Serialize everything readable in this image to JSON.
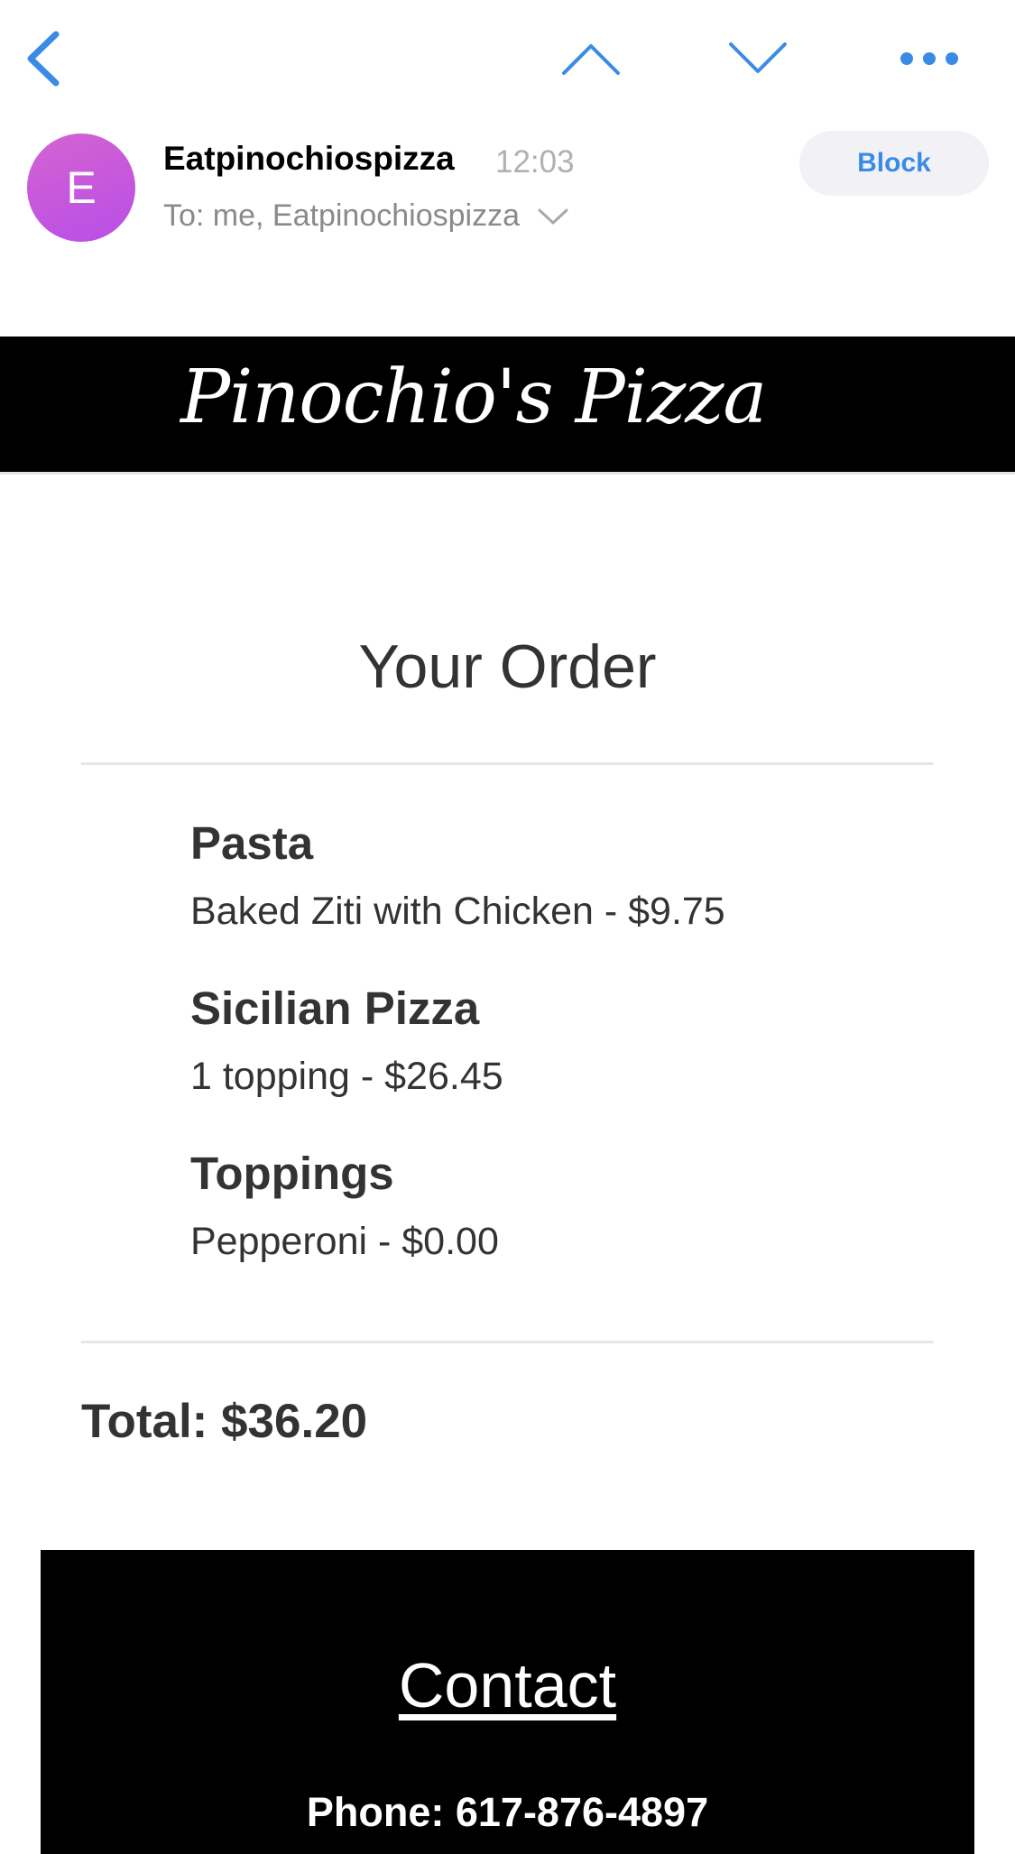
{
  "email": {
    "sender_initial": "E",
    "sender_name": "Eatpinochiospizza",
    "time": "12:03",
    "recipients": "To: me, Eatpinochiospizza",
    "block_label": "Block"
  },
  "colors": {
    "accent": "#3a8be6",
    "avatar_gradient_start": "#d463d0",
    "avatar_gradient_end": "#b84ee8",
    "banner_bg": "#000000",
    "text": "#333333"
  },
  "icons": {
    "back": "chevron-left-icon",
    "previous": "chevron-up-icon",
    "next": "chevron-down-icon",
    "more": "more-dots-icon",
    "recipients_expand": "chevron-down-icon"
  },
  "message": {
    "brand": "Pinochio's Pizza",
    "order_title": "Your Order",
    "groups": [
      {
        "title": "Pasta",
        "item": "Baked Ziti with Chicken - $9.75"
      },
      {
        "title": "Sicilian Pizza",
        "item": "1 topping - $26.45"
      },
      {
        "title": "Toppings",
        "item": "Pepperoni - $0.00"
      }
    ],
    "total": "Total: $36.20",
    "contact_title": "Contact",
    "contact_phone": "Phone: 617-876-4897"
  }
}
